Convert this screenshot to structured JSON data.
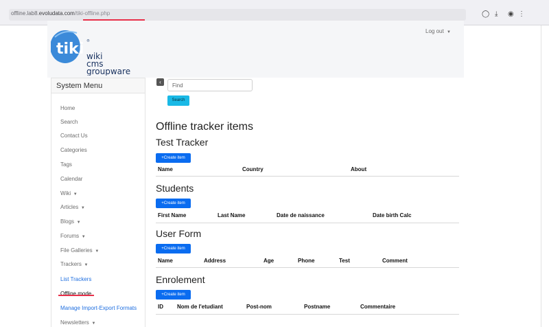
{
  "browser": {
    "url_domain": "offline.lab8.",
    "url_domain_bold": "evoludata.com",
    "url_path": "/tiki-offline.php",
    "icons": [
      "pocket-icon",
      "download-icon",
      "extension-icon"
    ]
  },
  "header": {
    "logo_text": [
      "wiki",
      "cms",
      "groupware"
    ],
    "logout_label": "Log out"
  },
  "menu": {
    "title": "System Menu",
    "items": [
      {
        "label": "Home",
        "caret": false,
        "style": "normal"
      },
      {
        "label": "Search",
        "caret": false,
        "style": "normal"
      },
      {
        "label": "Contact Us",
        "caret": false,
        "style": "normal"
      },
      {
        "label": "Categories",
        "caret": false,
        "style": "normal"
      },
      {
        "label": "Tags",
        "caret": false,
        "style": "normal"
      },
      {
        "label": "Calendar",
        "caret": false,
        "style": "normal"
      },
      {
        "label": "Wiki",
        "caret": true,
        "style": "normal"
      },
      {
        "label": "Articles",
        "caret": true,
        "style": "normal"
      },
      {
        "label": "Blogs",
        "caret": true,
        "style": "normal"
      },
      {
        "label": "Forums",
        "caret": true,
        "style": "normal"
      },
      {
        "label": "File Galleries",
        "caret": true,
        "style": "normal"
      },
      {
        "label": "Trackers",
        "caret": true,
        "style": "normal"
      },
      {
        "label": "List Trackers",
        "caret": false,
        "style": "link"
      },
      {
        "label": "Offline mode",
        "caret": false,
        "style": "active"
      },
      {
        "label": "Manage Import-Export Formats",
        "caret": false,
        "style": "link"
      },
      {
        "label": "Newsletters",
        "caret": true,
        "style": "normal"
      }
    ]
  },
  "search": {
    "placeholder": "Find",
    "button_label": "Search"
  },
  "main": {
    "title": "Offline tracker items",
    "create_label": "+Create item",
    "trackers": [
      {
        "name": "Test Tracker",
        "columns": [
          "Name",
          "Country",
          "About"
        ]
      },
      {
        "name": "Students",
        "columns": [
          "First Name",
          "Last Name",
          "Date de naissance",
          "Date birth Calc"
        ]
      },
      {
        "name": "User Form",
        "columns": [
          "Name",
          "Address",
          "Age",
          "Phone",
          "Test",
          "Comment"
        ]
      },
      {
        "name": "Enrolement",
        "columns": [
          "ID",
          "Nom de l'etudiant",
          "Post-nom",
          "Postname",
          "Commentaire"
        ]
      }
    ]
  },
  "colors": {
    "primary_button": "#0a6cf0",
    "search_button": "#19b9e6",
    "link": "#1f6fe0",
    "highlight_underline": "#e8304a"
  }
}
